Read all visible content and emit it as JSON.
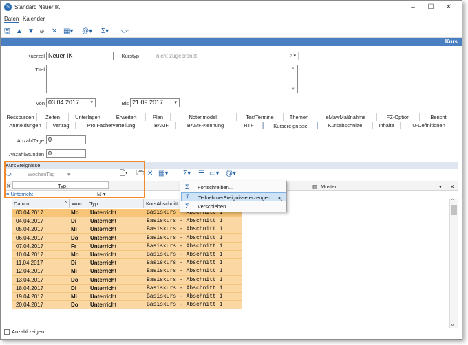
{
  "window": {
    "title": "Standard Neuer IK",
    "controls": [
      "–",
      "☐",
      "✕"
    ]
  },
  "menu": {
    "items": [
      "Daten",
      "Kalender"
    ]
  },
  "toolbar": {
    "icons": [
      "save-icon",
      "up-arrow-icon",
      "down-arrow-icon",
      "attach-icon",
      "delete-icon",
      "grid-icon",
      "at-icon",
      "sigma-icon",
      "link-icon"
    ]
  },
  "header_band": {
    "label": "Kurs"
  },
  "form": {
    "kuerzel_label": "Kuerzel",
    "kuerzel_value": "Neuer IK",
    "kurstyp_label": "Kurstyp",
    "kurstyp_value": "nicht zugeordnet",
    "titel_label": "Titel",
    "von_label": "Von",
    "von_value": "03.04.2017",
    "bis_label": "Bis",
    "bis_value": "21.09.2017",
    "anzahltage_label": "AnzahlTage",
    "anzahltage_value": "0",
    "anzahlstunden_label": "AnzahlStunden",
    "anzahlstunden_value": "0"
  },
  "tabs_row1": [
    "Ressourcen",
    "Zeiten",
    "Unterlagen",
    "Erweitert",
    "Plan",
    "Notenmodell",
    "TestTermine",
    "Themen",
    "eMawMaßnahme",
    "FZ-Option",
    "Bericht"
  ],
  "tabs_row2": [
    "Anmeldungen",
    "Vertrag",
    "Pro Fächerverteilung",
    "BAMF",
    "BAMF-Kennung",
    "RTF",
    "Kursereignisse",
    "Kursabschnitte",
    "Inhalte",
    "U-Definitionen"
  ],
  "active_tab": "Kursereignisse",
  "group": {
    "header": "KursEreignisse",
    "sort_field": "WochenTag",
    "filter_label": "Typ",
    "filter_value": "= Unterricht"
  },
  "grid_header": {
    "muster_label": "Muster"
  },
  "columns": [
    "Datum",
    "Woc",
    "Typ",
    "KursAbschnitt"
  ],
  "rows": [
    {
      "datum": "03.04.2017",
      "woc": "Mo",
      "typ": "Unterricht",
      "abschnitt": "Basiskurs - Abschnitt 1"
    },
    {
      "datum": "04.04.2017",
      "woc": "Di",
      "typ": "Unterricht",
      "abschnitt": "Basiskurs - Abschnitt 1"
    },
    {
      "datum": "05.04.2017",
      "woc": "Mi",
      "typ": "Unterricht",
      "abschnitt": "Basiskurs - Abschnitt 1"
    },
    {
      "datum": "06.04.2017",
      "woc": "Do",
      "typ": "Unterricht",
      "abschnitt": "Basiskurs - Abschnitt 1"
    },
    {
      "datum": "07.04.2017",
      "woc": "Fr",
      "typ": "Unterricht",
      "abschnitt": "Basiskurs - Abschnitt 1"
    },
    {
      "datum": "10.04.2017",
      "woc": "Mo",
      "typ": "Unterricht",
      "abschnitt": "Basiskurs - Abschnitt 1"
    },
    {
      "datum": "11.04.2017",
      "woc": "Di",
      "typ": "Unterricht",
      "abschnitt": "Basiskurs - Abschnitt 1"
    },
    {
      "datum": "12.04.2017",
      "woc": "Mi",
      "typ": "Unterricht",
      "abschnitt": "Basiskurs - Abschnitt 1"
    },
    {
      "datum": "13.04.2017",
      "woc": "Do",
      "typ": "Unterricht",
      "abschnitt": "Basiskurs - Abschnitt 1"
    },
    {
      "datum": "18.04.2017",
      "woc": "Di",
      "typ": "Unterricht",
      "abschnitt": "Basiskurs - Abschnitt 1"
    },
    {
      "datum": "19.04.2017",
      "woc": "Mi",
      "typ": "Unterricht",
      "abschnitt": "Basiskurs - Abschnitt 1"
    },
    {
      "datum": "20.04.2017",
      "woc": "Do",
      "typ": "Unterricht",
      "abschnitt": "Basiskurs - Abschnitt 1"
    }
  ],
  "context_menu": [
    {
      "label": "Fortschreiben..."
    },
    {
      "label": "TeilnehmerEreignisse erzeugen"
    },
    {
      "label": "Verschieben..."
    }
  ],
  "footer": {
    "checkbox_label": "Anzahl zeigen"
  },
  "colors": {
    "accent": "#4a7fc1",
    "row_fill": "#fbd7a3",
    "highlight_box": "#f08a2b",
    "menu_hover": "#cfe3f7"
  }
}
